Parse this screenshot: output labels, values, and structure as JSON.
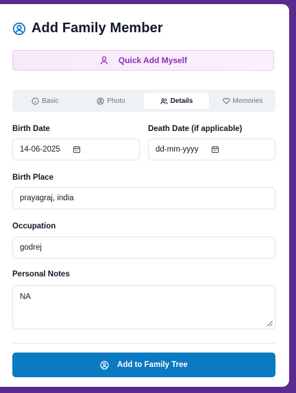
{
  "dialog": {
    "title": "Add Family Member",
    "quick_add_label": "Quick Add Myself",
    "submit_label": "Add to Family Tree"
  },
  "tabs": [
    {
      "label": "Basic",
      "icon": "info-circle-icon"
    },
    {
      "label": "Photo",
      "icon": "user-circle-icon"
    },
    {
      "label": "Details",
      "icon": "users-icon",
      "active": true
    },
    {
      "label": "Memories",
      "icon": "heart-icon"
    }
  ],
  "form": {
    "birth_date": {
      "label": "Birth Date",
      "value": "14-06-2025"
    },
    "death_date": {
      "label": "Death Date (if applicable)",
      "placeholder": "dd-mm-yyyy"
    },
    "birth_place": {
      "label": "Birth Place",
      "value": "prayagraj, india"
    },
    "occupation": {
      "label": "Occupation",
      "value": "godrej"
    },
    "personal_notes": {
      "label": "Personal Notes",
      "value": "NA"
    }
  },
  "colors": {
    "accent_blue": "#0a7ac2",
    "quick_add_purple": "#8b2fb8",
    "backdrop": "#5b2a8e"
  }
}
